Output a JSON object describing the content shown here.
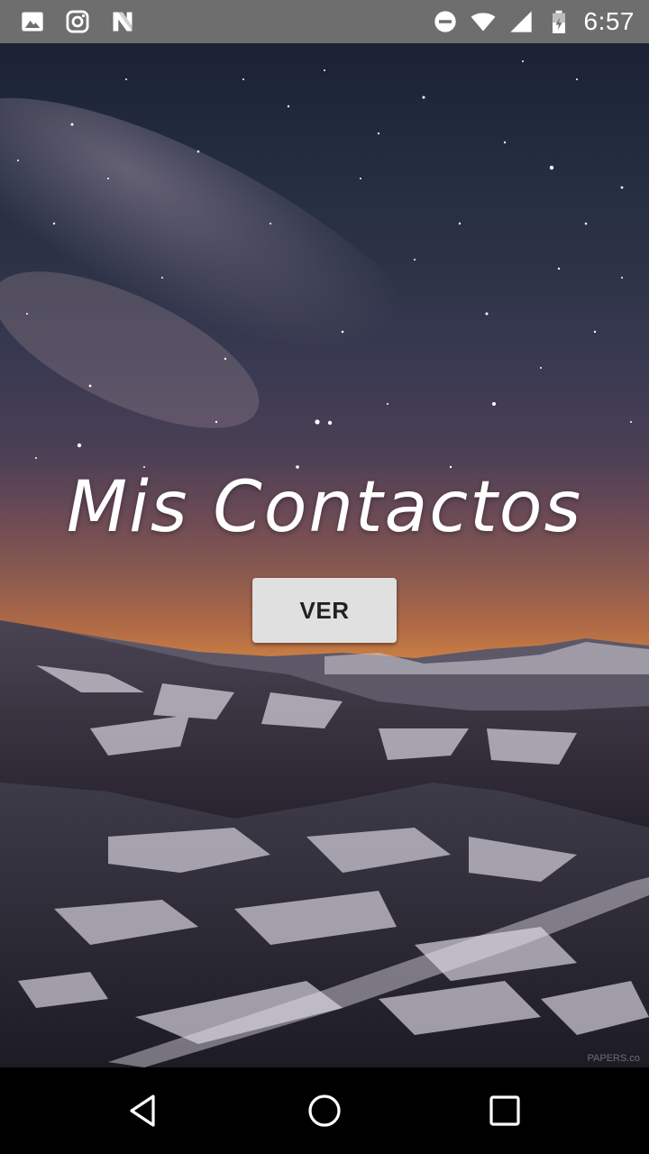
{
  "status_bar": {
    "time": "6:57",
    "left_icons": [
      "image-icon",
      "instagram-icon",
      "n-app-icon"
    ],
    "right_icons": [
      "do-not-disturb-icon",
      "wifi-icon",
      "cell-signal-icon",
      "battery-icon"
    ]
  },
  "main": {
    "title": "Mis Contactos",
    "button_label": "VER",
    "watermark": "PAPERS.co"
  },
  "nav_bar": {
    "icons": [
      "back-icon",
      "home-icon",
      "recents-icon"
    ]
  },
  "colors": {
    "status_bar_bg": "#6e6e6e",
    "button_bg": "#e0e0e0",
    "nav_bar_bg": "#000000"
  }
}
